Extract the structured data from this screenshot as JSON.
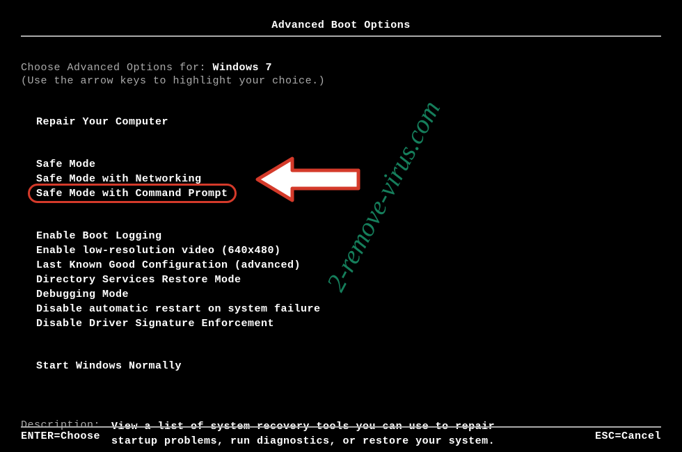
{
  "title": "Advanced Boot Options",
  "choose_prefix": "Choose Advanced Options for: ",
  "os_name": "Windows 7",
  "hint": "(Use the arrow keys to highlight your choice.)",
  "groups": [
    {
      "items": [
        "Repair Your Computer"
      ]
    },
    {
      "items": [
        "Safe Mode",
        "Safe Mode with Networking",
        "Safe Mode with Command Prompt"
      ],
      "highlight_index": 2
    },
    {
      "items": [
        "Enable Boot Logging",
        "Enable low-resolution video (640x480)",
        "Last Known Good Configuration (advanced)",
        "Directory Services Restore Mode",
        "Debugging Mode",
        "Disable automatic restart on system failure",
        "Disable Driver Signature Enforcement"
      ]
    },
    {
      "items": [
        "Start Windows Normally"
      ]
    }
  ],
  "description_label": "Description:",
  "description_text": "View a list of system recovery tools you can use to repair startup problems, run diagnostics, or restore your system.",
  "footer_left": "ENTER=Choose",
  "footer_right": "ESC=Cancel",
  "watermark": "2-remove-virus.com"
}
